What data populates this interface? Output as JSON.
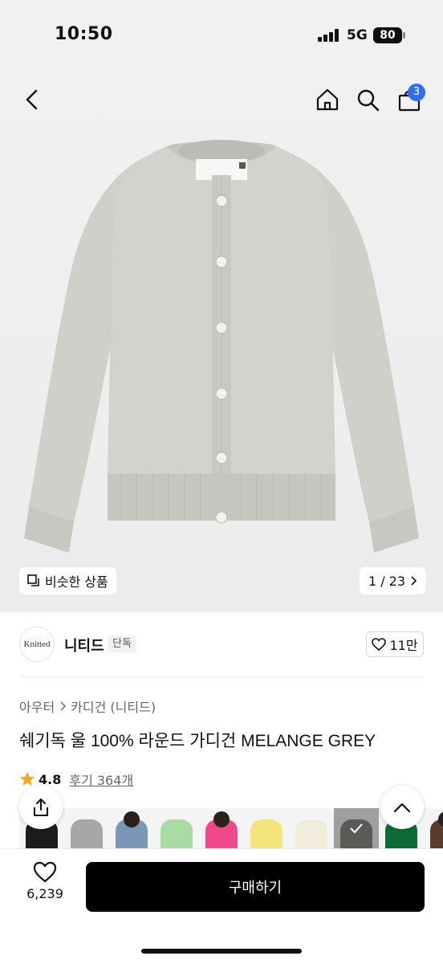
{
  "status_bar": {
    "time": "10:50",
    "network": "5G",
    "battery": "80"
  },
  "nav": {
    "cart_count": "3"
  },
  "gallery": {
    "similar_label": "비슷한 상품",
    "counter": "1 / 23"
  },
  "brand": {
    "logo_text": "Knitted",
    "name": "니티드",
    "badge": "단독",
    "like_count": "11만"
  },
  "product": {
    "breadcrumb": [
      "아우터",
      "카디건 (니티드)"
    ],
    "title": "쉐기독 울 100% 라운드 가디건 MELANGE GREY",
    "rating": "4.8",
    "reviews": "후기 364개"
  },
  "swatches": [
    {
      "color": "#1c1c1c",
      "type": "garment"
    },
    {
      "color": "#a7a7a7",
      "type": "garment"
    },
    {
      "color": "#7c95b6",
      "type": "photo"
    },
    {
      "color": "#a9dba5",
      "type": "garment"
    },
    {
      "color": "#f0498a",
      "type": "photo"
    },
    {
      "color": "#f3e57c",
      "type": "garment"
    },
    {
      "color": "#f1ecdc",
      "type": "garment"
    },
    {
      "color": "#8a8a86",
      "type": "selected"
    },
    {
      "color": "#0f6a38",
      "type": "garment"
    },
    {
      "color": "#5a3c2e",
      "type": "photo"
    }
  ],
  "bottom_bar": {
    "wish_count": "6,239",
    "buy_label": "구매하기"
  },
  "colors": {
    "accent_badge": "#2f6ef2",
    "buy_button": "#000000",
    "rating_star": "#f5a623",
    "cardigan": "#d3d1cc"
  }
}
